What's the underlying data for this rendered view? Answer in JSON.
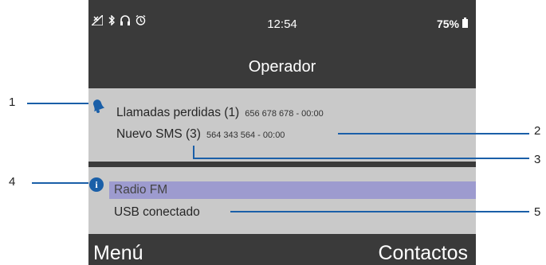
{
  "status_bar": {
    "icons": [
      "signal-icon",
      "bluetooth-icon",
      "headset-icon",
      "alarm-icon"
    ],
    "time": "12:54",
    "battery_percent": "75%"
  },
  "screen_title": "Operador",
  "notifications": {
    "icon": "bell-icon",
    "missed_calls": {
      "label": "Llamadas perdidas (1)",
      "detail": "656 678 678 - 00:00"
    },
    "new_sms": {
      "label": "Nuevo SMS (3)",
      "detail": "564 343 564 - 00:00"
    }
  },
  "info": {
    "icon": "info-icon",
    "radio": "Radio FM",
    "usb": "USB conectado"
  },
  "softkeys": {
    "left": "Menú",
    "right": "Contactos"
  },
  "callouts": [
    "1",
    "2",
    "3",
    "4",
    "5"
  ],
  "colors": {
    "phone_bg": "#3a3a3a",
    "panel_bg": "#c9c9c9",
    "highlight": "#9d9bcf",
    "callout": "#1a5fa8"
  }
}
